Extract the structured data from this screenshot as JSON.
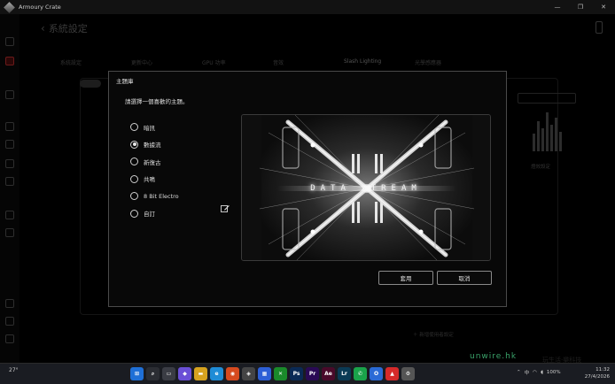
{
  "window": {
    "app_title": "Armoury Crate",
    "controls": [
      "—",
      "❐",
      "✕"
    ]
  },
  "background": {
    "page_title": "系統設定",
    "tabs": [
      "系統設定",
      "更新中心",
      "GPU 功率",
      "音效",
      "Slash Lighting",
      "光學感應器"
    ],
    "side_label": "燈效設定",
    "mid_label": "＋ 新增使用者設定"
  },
  "dialog": {
    "title": "主題庫",
    "prompt": "請選擇一個喜歡的主題。",
    "options": [
      {
        "label": "暗訊",
        "checked": false
      },
      {
        "label": "數據流",
        "checked": true
      },
      {
        "label": "新復古",
        "checked": false
      },
      {
        "label": "共鳴",
        "checked": false
      },
      {
        "label": "8 Bit Electro",
        "checked": false
      },
      {
        "label": "自訂",
        "checked": false
      }
    ],
    "preview_text": "DATA STREAM",
    "apply_label": "套用",
    "cancel_label": "取消"
  },
  "taskbar": {
    "weather_temp": "27°",
    "battery": "100%",
    "time": "11:32",
    "date": "27/4/2026",
    "lang": "中",
    "watermark": "unwire.hk",
    "watermark_sub": "玩生活·樂科技"
  },
  "colors": {
    "accent_red": "#6b1a1a",
    "watermark_green": "#3aa36a"
  }
}
